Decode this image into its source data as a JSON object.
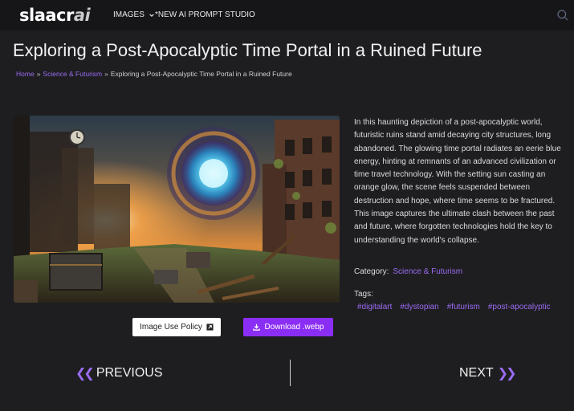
{
  "header": {
    "logo_main": "slaacr",
    "logo_ai": "ai",
    "nav_images": "IMAGES",
    "nav_studio": "*NEW AI PROMPT STUDIO"
  },
  "page": {
    "title": "Exploring a Post-Apocalyptic Time Portal in a Ruined Future"
  },
  "breadcrumb": {
    "home": "Home",
    "sep": "»",
    "category": "Science & Futurism",
    "current": "Exploring a Post-Apocalyptic Time Portal in a Ruined Future"
  },
  "description": "In this haunting depiction of a post-apocalyptic world, futuristic ruins stand amid decaying city structures, long abandoned. The glowing time portal radiates an eerie blue energy, hinting at remnants of an advanced civilization or time travel technology. With the setting sun casting an orange glow, the scene feels suspended between destruction and hope, where time seems to be fractured. This image captures the ultimate clash between the past and future, where forgotten technologies hold the key to understanding the world's collapse.",
  "meta": {
    "category_label": "Category:",
    "category_value": "Science & Futurism",
    "tags_label": "Tags:",
    "tags": [
      "#digitalart",
      "#dystopian",
      "#futurism",
      "#post-apocalyptic"
    ]
  },
  "buttons": {
    "policy": "Image Use Policy",
    "download": "Download .webp"
  },
  "pagination": {
    "previous": "PREVIOUS",
    "next": "NEXT"
  },
  "colors": {
    "accent": "#8b2ef5",
    "link": "#9b6cf2",
    "background": "#1e1e21"
  }
}
